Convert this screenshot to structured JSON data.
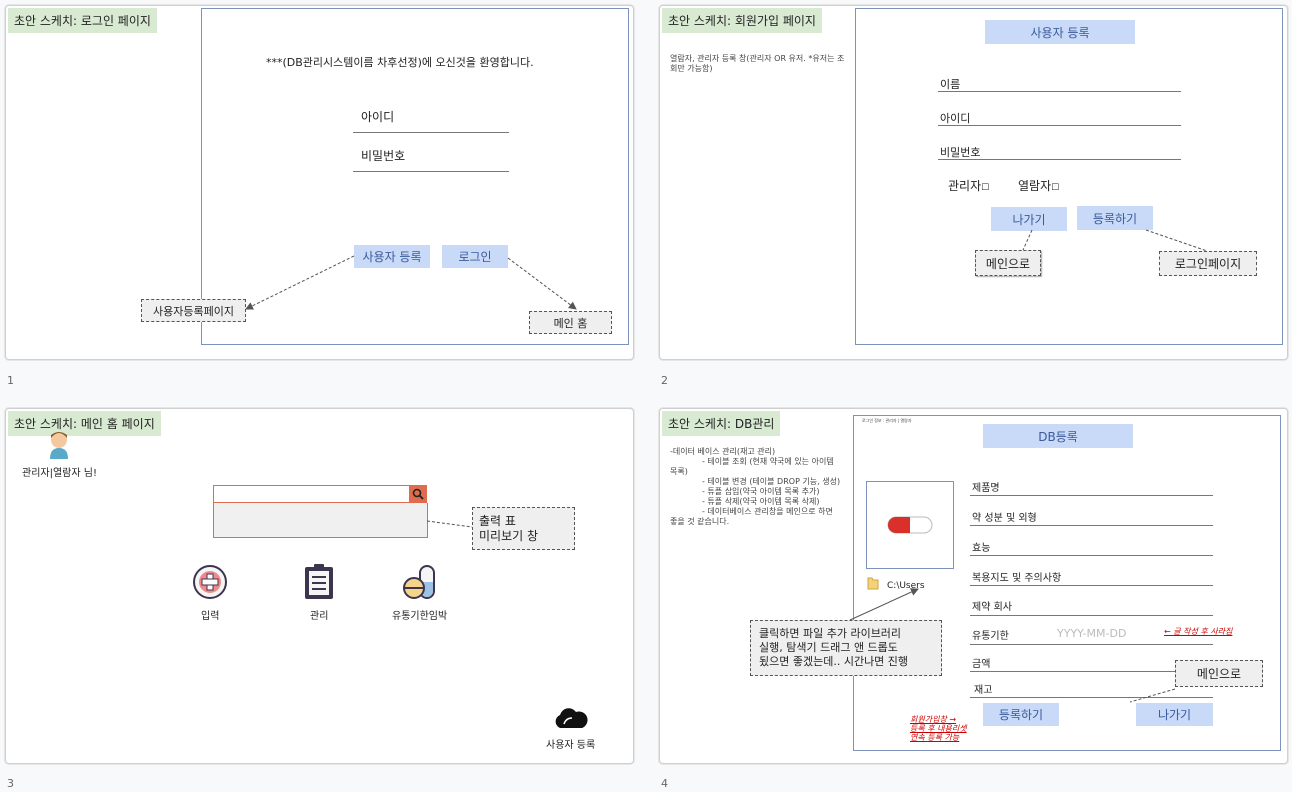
{
  "slides": [
    {
      "number": "1",
      "title": "초안 스케치: 로그인 페이지",
      "welcome": "***(DB관리시스템이름 차후선정)에 오신것을 환영합니다.",
      "id_label": "아이디",
      "pw_label": "비밀번호",
      "register_button": "사용자 등록",
      "login_button": "로그인",
      "note_register": "사용자등록페이지",
      "note_home": "메인 홈"
    },
    {
      "number": "2",
      "title": "초안 스케치: 회원가입 페이지",
      "description": "열람자, 관리자 등록 창(관리자 OR 유저. *유저는 조회만 가능함)",
      "header": "사용자 등록",
      "fields": [
        "이름",
        "아이디",
        "비밀번호"
      ],
      "role_admin": "관리자",
      "role_viewer": "열람자",
      "exit_button": "나가기",
      "submit_button": "등록하기",
      "note_main": "메인으로",
      "note_login": "로그인페이지"
    },
    {
      "number": "3",
      "title": "초안 스케치: 메인 홈 페이지",
      "user_greeting": "관리자|열람자 님!",
      "preview_note_line1": "출력 표",
      "preview_note_line2": "미리보기 창",
      "icon_input_label": "입력",
      "icon_manage_label": "관리",
      "icon_expiry_label": "유통기한임박",
      "cloud_label": "사용자 등록"
    },
    {
      "number": "4",
      "title": "초안 스케치: DB관리",
      "description_lines": [
        "-데이터 베이스 관리(재고 관리)",
        "- 테이블 조회 (현재 약국에 있는 아이템",
        "목록)",
        "- 테이블 변경 (테이블 DROP 기능, 생성)",
        "- 튜플 삽입(약국 아이템 목록 추가)",
        "- 튜플 삭제(약국 아이템 목록 삭제)",
        "- 데이터베이스 관리창을 메인으로 하면",
        "좋을 것 같습니다."
      ],
      "tiny_header": "로그인 정보 : 관리자 | 열람자",
      "header": "DB등록",
      "file_path": "C:\\Users",
      "fields": [
        "제품명",
        "약 성분 및 외형",
        "효능",
        "복용지도 및 주의사항",
        "제약 회사",
        "유통기한",
        "금액",
        "재고"
      ],
      "date_placeholder": "YYYY-MM-DD",
      "date_note": "← 글 작성 후 사라짐",
      "file_note_lines": [
        "클릭하면 파일 추가 라이브러리",
        "실행, 탐색기 드래그 앤 드롭도",
        "됬으면 좋겠는데.. 시간나면 진행"
      ],
      "register_button": "등록하기",
      "exit_button": "나가기",
      "note_main": "메인으로",
      "red_note_lines": [
        "회원가입창 →",
        "등록 후 내용리셋",
        "연속 등록 가능"
      ]
    }
  ],
  "colors": {
    "title_bg": "#d9ead3",
    "button_bg": "#c9daf8",
    "note_bg": "#efefef",
    "search_accent": "#e06c4f"
  }
}
